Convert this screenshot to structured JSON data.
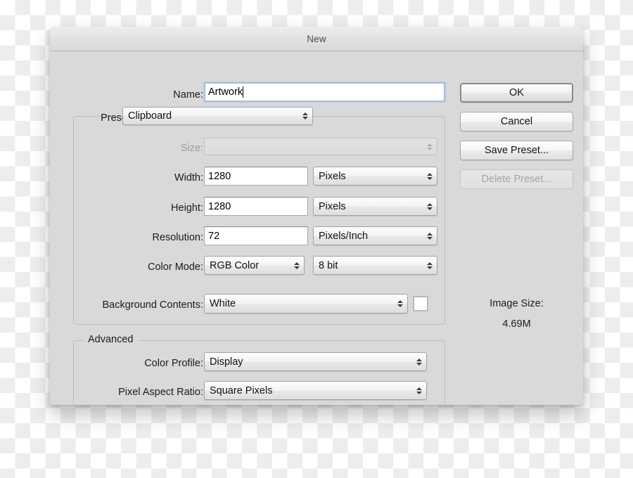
{
  "window": {
    "title": "New"
  },
  "form": {
    "name": {
      "label": "Name:",
      "value": "Artwork"
    },
    "preset": {
      "label": "Preset:",
      "value": "Clipboard"
    },
    "size": {
      "label": "Size:",
      "value": "",
      "disabled": true
    },
    "width": {
      "label": "Width:",
      "value": "1280",
      "unit": "Pixels"
    },
    "height": {
      "label": "Height:",
      "value": "1280",
      "unit": "Pixels"
    },
    "resolution": {
      "label": "Resolution:",
      "value": "72",
      "unit": "Pixels/Inch"
    },
    "color_mode": {
      "label": "Color Mode:",
      "value": "RGB Color",
      "depth": "8 bit"
    },
    "background_contents": {
      "label": "Background Contents:",
      "value": "White",
      "swatch_color": "#ffffff"
    }
  },
  "advanced": {
    "legend": "Advanced",
    "color_profile": {
      "label": "Color Profile:",
      "value": "Display"
    },
    "pixel_aspect_ratio": {
      "label": "Pixel Aspect Ratio:",
      "value": "Square Pixels"
    }
  },
  "buttons": {
    "ok": "OK",
    "cancel": "Cancel",
    "save_preset": "Save Preset...",
    "delete_preset": "Delete Preset..."
  },
  "image_size": {
    "label": "Image Size:",
    "value": "4.69M"
  },
  "colors": {
    "dialog_bg": "#d9d9d9",
    "focus_border": "#a6c0dc",
    "text": "#1b1b1b",
    "disabled_text": "#9a9a9a"
  }
}
